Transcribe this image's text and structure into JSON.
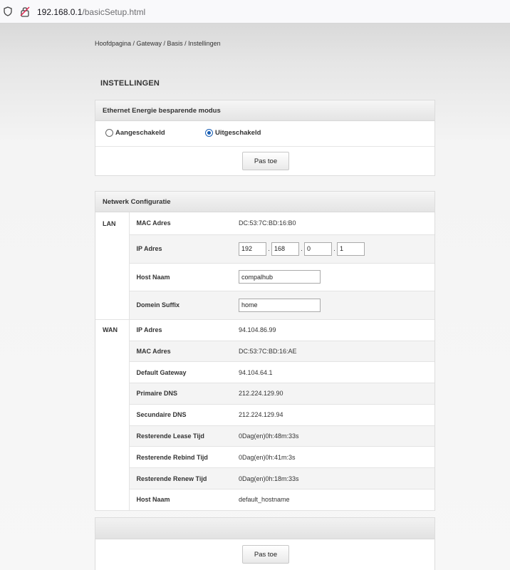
{
  "browser": {
    "url_host": "192.168.0.1",
    "url_path": "/basicSetup.html"
  },
  "breadcrumb": "Hoofdpagina / Gateway / Basis / Instellingen",
  "page_title": "INSTELLINGEN",
  "ethernet": {
    "header": "Ethernet Energie besparende modus",
    "option_on": "Aangeschakeld",
    "option_off": "Uitgeschakeld",
    "selected": "Uitgeschakeld",
    "apply_label": "Pas toe"
  },
  "network": {
    "header": "Netwerk Configuratie",
    "lan_label": "LAN",
    "wan_label": "WAN",
    "lan": {
      "mac_label": "MAC Adres",
      "mac_value": "DC:53:7C:BD:16:B0",
      "ip_label": "IP Adres",
      "ip_octets": [
        "192",
        "168",
        "0",
        "1"
      ],
      "ip_separator": ".",
      "host_label": "Host Naam",
      "host_value": "compalhub",
      "domain_label": "Domein Suffix",
      "domain_value": "home"
    },
    "wan_rows": [
      {
        "label": "IP Adres",
        "value": "94.104.86.99"
      },
      {
        "label": "MAC Adres",
        "value": "DC:53:7C:BD:16:AE"
      },
      {
        "label": "Default Gateway",
        "value": "94.104.64.1"
      },
      {
        "label": "Primaire DNS",
        "value": "212.224.129.90"
      },
      {
        "label": "Secundaire DNS",
        "value": "212.224.129.94"
      },
      {
        "label": "Resterende Lease Tijd",
        "value": "0Dag(en)0h:48m:33s"
      },
      {
        "label": "Resterende Rebind Tijd",
        "value": "0Dag(en)0h:41m:3s"
      },
      {
        "label": "Resterende Renew Tijd",
        "value": "0Dag(en)0h:18m:33s"
      },
      {
        "label": "Host Naam",
        "value": "default_hostname"
      }
    ]
  },
  "footer": {
    "apply_label": "Pas toe"
  }
}
